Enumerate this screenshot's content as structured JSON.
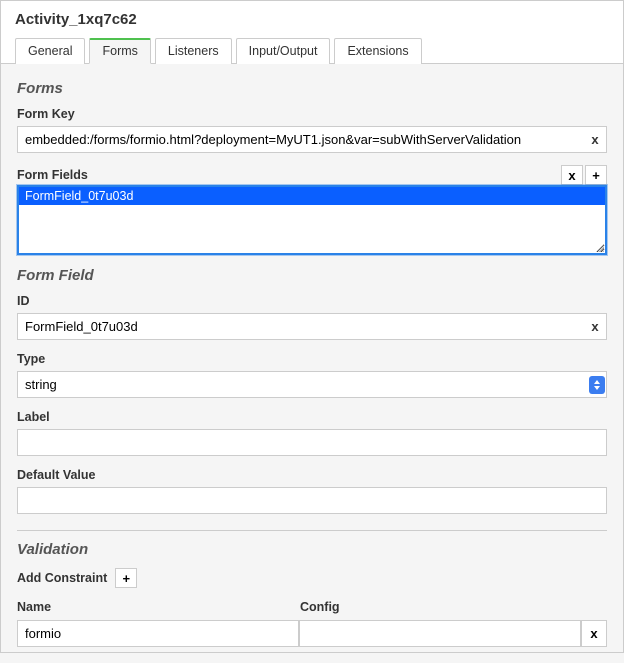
{
  "title": "Activity_1xq7c62",
  "tabs": [
    {
      "label": "General"
    },
    {
      "label": "Forms"
    },
    {
      "label": "Listeners"
    },
    {
      "label": "Input/Output"
    },
    {
      "label": "Extensions"
    }
  ],
  "forms": {
    "section_title": "Forms",
    "form_key_label": "Form Key",
    "form_key_value": "embedded:/forms/formio.html?deployment=MyUT1.json&var=subWithServerValidation",
    "form_fields_label": "Form Fields",
    "form_fields_items": [
      {
        "label": "FormField_0t7u03d"
      }
    ]
  },
  "form_field": {
    "section_title": "Form Field",
    "id_label": "ID",
    "id_value": "FormField_0t7u03d",
    "type_label": "Type",
    "type_value": "string",
    "label_label": "Label",
    "label_value": "",
    "default_value_label": "Default Value",
    "default_value_value": ""
  },
  "validation": {
    "section_title": "Validation",
    "add_constraint_label": "Add Constraint",
    "col_name": "Name",
    "col_config": "Config",
    "rows": [
      {
        "name": "formio",
        "config": ""
      }
    ]
  },
  "buttons": {
    "clear": "x",
    "add": "+"
  }
}
